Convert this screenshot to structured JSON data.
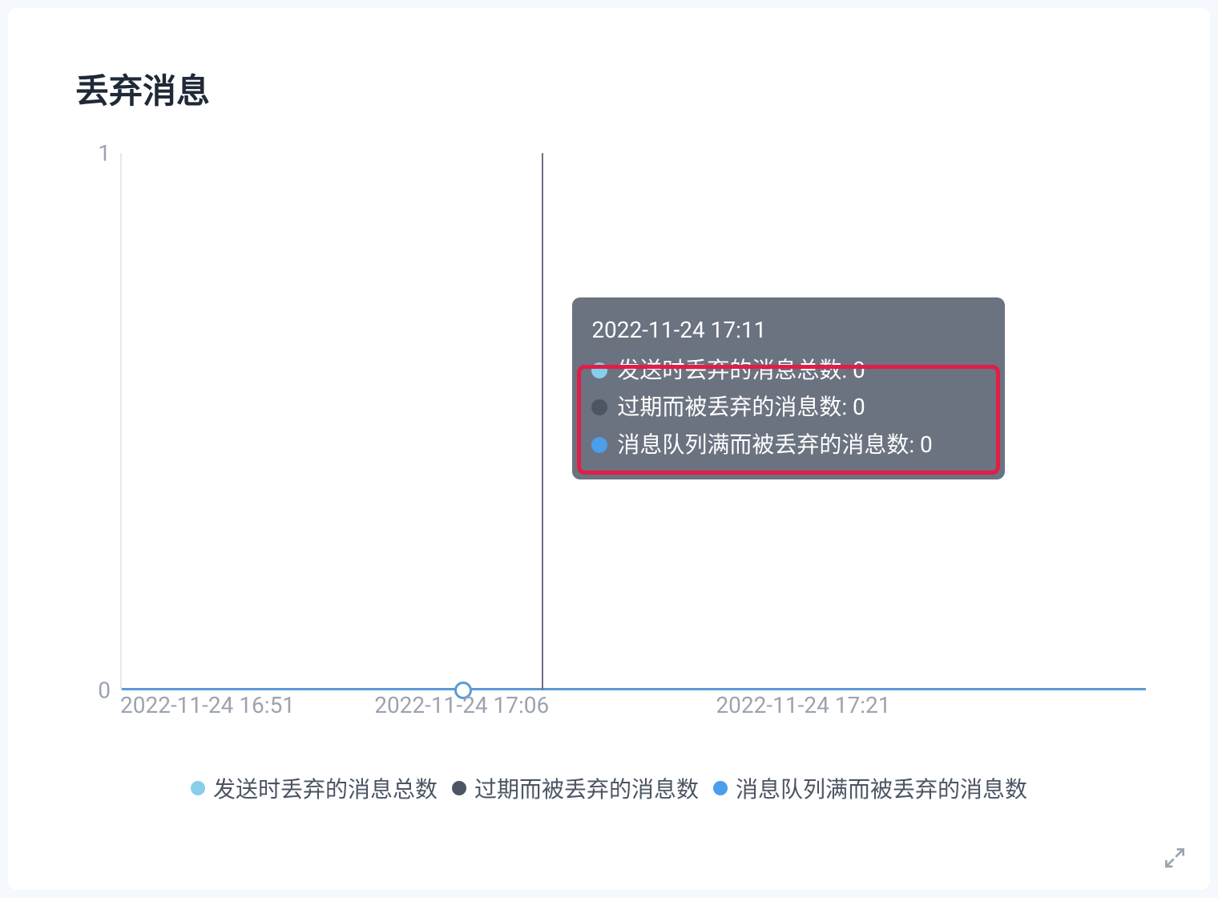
{
  "chart": {
    "title": "丢弃消息",
    "y_ticks": [
      "1",
      "0"
    ],
    "x_ticks": [
      "2022-11-24 16:51",
      "2022-11-24 17:06",
      "2022-11-24 17:21"
    ],
    "legend": [
      {
        "label": "发送时丢弃的消息总数",
        "color": "#87ceeb"
      },
      {
        "label": "过期而被丢弃的消息数",
        "color": "#4b5563"
      },
      {
        "label": "消息队列满而被丢弃的消息数",
        "color": "#4a9eea"
      }
    ],
    "tooltip": {
      "timestamp": "2022-11-24 17:11",
      "rows": [
        {
          "label": "发送时丢弃的消息总数: 0",
          "color": "#87ceeb"
        },
        {
          "label": "过期而被丢弃的消息数: 0",
          "color": "#4b5563"
        },
        {
          "label": "消息队列满而被丢弃的消息数: 0",
          "color": "#4a9eea"
        }
      ]
    }
  },
  "chart_data": {
    "type": "line",
    "title": "丢弃消息",
    "xlabel": "",
    "ylabel": "",
    "ylim": [
      0,
      1
    ],
    "x": [
      "2022-11-24 16:51",
      "2022-11-24 17:06",
      "2022-11-24 17:11",
      "2022-11-24 17:21"
    ],
    "series": [
      {
        "name": "发送时丢弃的消息总数",
        "values": [
          0,
          0,
          0,
          0
        ]
      },
      {
        "name": "过期而被丢弃的消息数",
        "values": [
          0,
          0,
          0,
          0
        ]
      },
      {
        "name": "消息队列满而被丢弃的消息数",
        "values": [
          0,
          0,
          0,
          0
        ]
      }
    ],
    "hover_point": {
      "x": "2022-11-24 17:11",
      "values": {
        "发送时丢弃的消息总数": 0,
        "过期而被丢弃的消息数": 0,
        "消息队列满而被丢弃的消息数": 0
      }
    }
  }
}
